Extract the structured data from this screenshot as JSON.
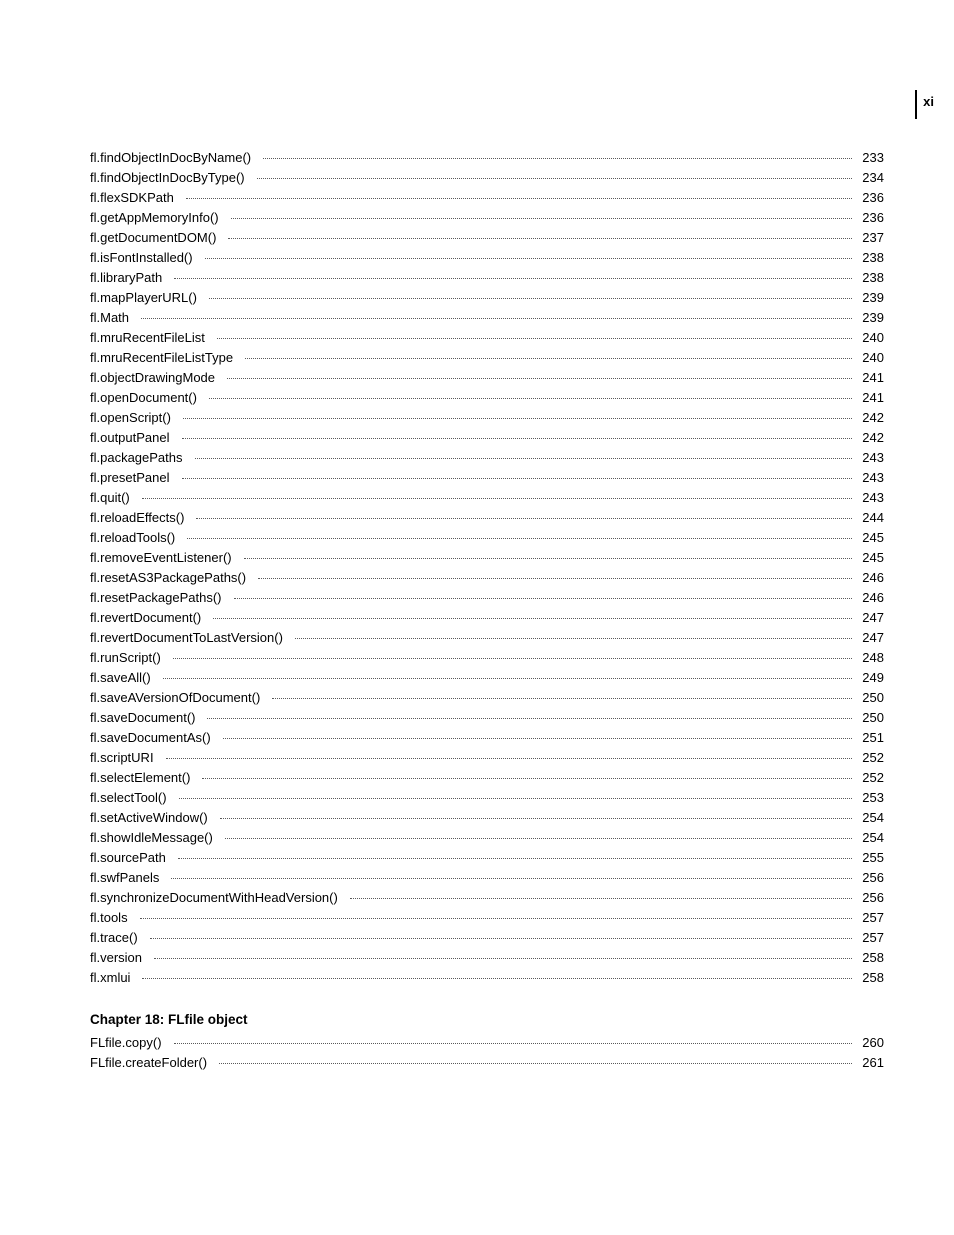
{
  "page_marker": "xi",
  "toc": [
    {
      "label": "fl.findObjectInDocByName()",
      "page": "233"
    },
    {
      "label": "fl.findObjectInDocByType()",
      "page": "234"
    },
    {
      "label": "fl.flexSDKPath",
      "page": "236"
    },
    {
      "label": "fl.getAppMemoryInfo()",
      "page": "236"
    },
    {
      "label": "fl.getDocumentDOM()",
      "page": "237"
    },
    {
      "label": "fl.isFontInstalled()",
      "page": "238"
    },
    {
      "label": "fl.libraryPath",
      "page": "238"
    },
    {
      "label": "fl.mapPlayerURL()",
      "page": "239"
    },
    {
      "label": "fl.Math",
      "page": "239"
    },
    {
      "label": "fl.mruRecentFileList",
      "page": "240"
    },
    {
      "label": "fl.mruRecentFileListType",
      "page": "240"
    },
    {
      "label": "fl.objectDrawingMode",
      "page": "241"
    },
    {
      "label": "fl.openDocument()",
      "page": "241"
    },
    {
      "label": "fl.openScript()",
      "page": "242"
    },
    {
      "label": "fl.outputPanel",
      "page": "242"
    },
    {
      "label": "fl.packagePaths",
      "page": "243"
    },
    {
      "label": "fl.presetPanel",
      "page": "243"
    },
    {
      "label": "fl.quit()",
      "page": "243"
    },
    {
      "label": "fl.reloadEffects()",
      "page": "244"
    },
    {
      "label": "fl.reloadTools()",
      "page": "245"
    },
    {
      "label": "fl.removeEventListener()",
      "page": "245"
    },
    {
      "label": "fl.resetAS3PackagePaths()",
      "page": "246"
    },
    {
      "label": "fl.resetPackagePaths()",
      "page": "246"
    },
    {
      "label": "fl.revertDocument()",
      "page": "247"
    },
    {
      "label": "fl.revertDocumentToLastVersion()",
      "page": "247"
    },
    {
      "label": "fl.runScript()",
      "page": "248"
    },
    {
      "label": "fl.saveAll()",
      "page": "249"
    },
    {
      "label": "fl.saveAVersionOfDocument()",
      "page": "250"
    },
    {
      "label": "fl.saveDocument()",
      "page": "250"
    },
    {
      "label": "fl.saveDocumentAs()",
      "page": "251"
    },
    {
      "label": "fl.scriptURI",
      "page": "252"
    },
    {
      "label": "fl.selectElement()",
      "page": "252"
    },
    {
      "label": "fl.selectTool()",
      "page": "253"
    },
    {
      "label": "fl.setActiveWindow()",
      "page": "254"
    },
    {
      "label": "fl.showIdleMessage()",
      "page": "254"
    },
    {
      "label": "fl.sourcePath",
      "page": "255"
    },
    {
      "label": "fl.swfPanels",
      "page": "256"
    },
    {
      "label": "fl.synchronizeDocumentWithHeadVersion()",
      "page": "256"
    },
    {
      "label": "fl.tools",
      "page": "257"
    },
    {
      "label": "fl.trace()",
      "page": "257"
    },
    {
      "label": "fl.version",
      "page": "258"
    },
    {
      "label": "fl.xmlui",
      "page": "258"
    }
  ],
  "chapter": {
    "title": "Chapter 18: FLfile object",
    "entries": [
      {
        "label": "FLfile.copy()",
        "page": "260"
      },
      {
        "label": "FLfile.createFolder()",
        "page": "261"
      }
    ]
  }
}
